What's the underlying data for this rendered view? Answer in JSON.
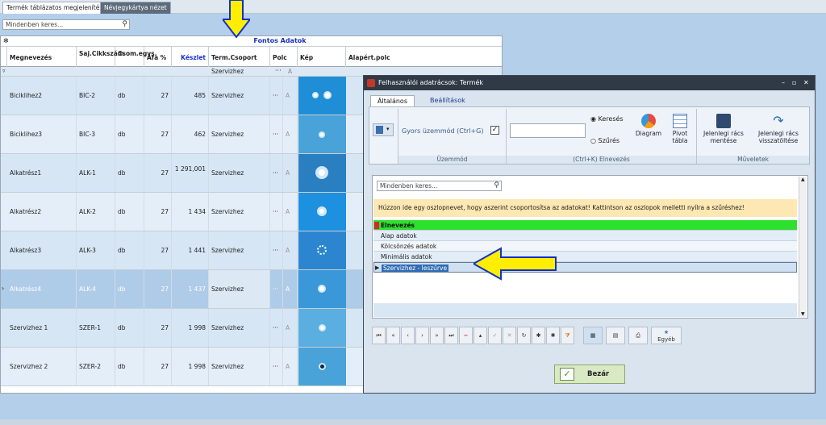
{
  "tabs": {
    "tab1": "Termék táblázatos megjelenítés",
    "tab2": "Névjegykártya nézet"
  },
  "search": {
    "placeholder": "Mindenben keres...",
    "icon": "search-icon"
  },
  "grid": {
    "band": "Fontos Adatok",
    "columns": {
      "name": "Megnevezés",
      "code": "Saj.Cikkszám",
      "unit": "Csom.egys.",
      "vat": "Áfa %",
      "stock": "Készlet",
      "group": "Term.Csoport",
      "shelf": "Polc",
      "image": "Kép",
      "price": "Alapért.polc"
    },
    "filter_value": "Szervizhez",
    "rows": [
      {
        "name": "Biciklihez2",
        "code": "BIC-2",
        "unit": "db",
        "vat": "27",
        "stock": "485",
        "group": "Szervizhez",
        "dots": "···",
        "shelf": "A"
      },
      {
        "name": "Biciklihez3",
        "code": "BIC-3",
        "unit": "db",
        "vat": "27",
        "stock": "462",
        "group": "Szervizhez",
        "dots": "···",
        "shelf": "A"
      },
      {
        "name": "Alkatrész1",
        "code": "ALK-1",
        "unit": "db",
        "vat": "27",
        "stock": "1 291,001",
        "group": "Szervizhez",
        "dots": "···",
        "shelf": "A"
      },
      {
        "name": "Alkatrész2",
        "code": "ALK-2",
        "unit": "db",
        "vat": "27",
        "stock": "1 434",
        "group": "Szervizhez",
        "dots": "···",
        "shelf": "A"
      },
      {
        "name": "Alkatrész3",
        "code": "ALK-3",
        "unit": "db",
        "vat": "27",
        "stock": "1 441",
        "group": "Szervizhez",
        "dots": "···",
        "shelf": "A"
      },
      {
        "name": "Alkatrész4",
        "code": "ALK-4",
        "unit": "db",
        "vat": "27",
        "stock": "1 437",
        "group": "Szervizhez",
        "dots": "···",
        "shelf": "A"
      },
      {
        "name": "Szervizhez 1",
        "code": "SZER-1",
        "unit": "db",
        "vat": "27",
        "stock": "1 998",
        "group": "Szervizhez",
        "dots": "···",
        "shelf": "A"
      },
      {
        "name": "Szervizhez 2",
        "code": "SZER-2",
        "unit": "db",
        "vat": "27",
        "stock": "1 998",
        "group": "Szervizhez",
        "dots": "···",
        "shelf": "A"
      }
    ]
  },
  "dialog": {
    "title": "Felhasználói adatrácsok: Termék",
    "tabs": {
      "general": "Általános",
      "settings": "Beállítások"
    },
    "ribbon": {
      "quick_mode": "Gyors üzemmód (Ctrl+G)",
      "mode_group": "Üzemmód",
      "search_radio": "Keresés",
      "filter_radio": "Szűrés",
      "diagram": "Diagram",
      "pivot": "Pivot tábla",
      "rename_group": "(Ctrl+K) Elnevezés",
      "save_grid": "Jelenlegi rács mentése",
      "load_grid": "Jelenlegi rács visszatöltése",
      "ops_group": "Műveletek"
    },
    "search_placeholder": "Mindenben keres...",
    "notice": "Húzzon ide egy oszlopnevet, hogy aszerint csoportosítsa az adatokat! Kattintson az oszlopok melletti nyílra a szűréshez!",
    "list_header": "Elnevezés",
    "list": [
      "Alap adatok",
      "Kölcsönzés adatok",
      "Minimális adatok",
      "Szervizhez - leszűrve"
    ],
    "other_btn": "Egyéb",
    "close_btn": "Bezár"
  },
  "colors": {
    "accent": "#1530c8",
    "highlight_green": "#2ee02e",
    "arrow_yellow": "#ffee00"
  }
}
